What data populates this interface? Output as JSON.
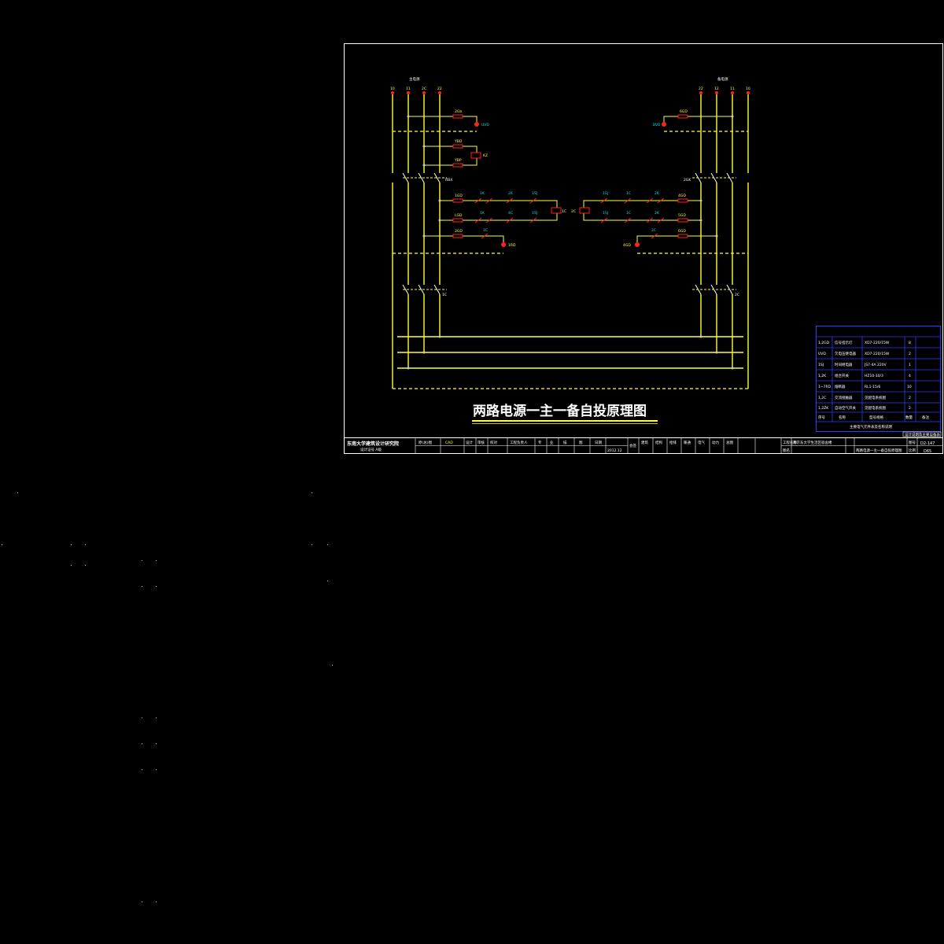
{
  "diagram": {
    "title": "两路电源一主一备自投原理图",
    "left_source_label": "主电源",
    "right_source_label": "备电源",
    "left_phases": [
      "10",
      "11",
      "2C",
      "22"
    ],
    "right_phases": [
      "22",
      "12",
      "11",
      "10"
    ],
    "left_upper_labels": [
      "2Gb",
      "UVD",
      "YBD",
      "YBP",
      "KZ",
      "RBX"
    ],
    "left_relay_labels": [
      "1GD",
      "1K",
      "2K",
      "1SJ",
      "1C",
      "LGD",
      "1K",
      "4C",
      "1SJ",
      "2GD",
      "1C",
      "1RD",
      "1C"
    ],
    "right_upper_labels": [
      "6GD",
      "BVD",
      "2GK"
    ],
    "right_relay_labels": [
      "1SJ",
      "1C",
      "2K",
      "4GD",
      "2C",
      "1SJ",
      "1C",
      "2K",
      "5GD",
      "2C",
      "6GD",
      "4GD",
      "2C"
    ]
  },
  "legend": {
    "rows": [
      [
        "1,2GD",
        "信号指示灯",
        "XD7-220/15W",
        "8",
        ""
      ],
      [
        "UVD",
        "欠电压继电器",
        "XD7-220/15W",
        "2",
        ""
      ],
      [
        "1SJ",
        "时间继电器",
        "JS7-4A 220V",
        "1",
        ""
      ],
      [
        "1,2K",
        "组合开关",
        "HZ10-10/3",
        "4",
        ""
      ],
      [
        "1~7RD",
        "熔断器",
        "RL1-15/6",
        "10",
        ""
      ],
      [
        "1,2C",
        "交流接触器",
        "见配电系统图",
        "2",
        ""
      ],
      [
        "1,2ZK",
        "自动空气开关",
        "见配电系统图",
        "2",
        ""
      ],
      [
        "序号",
        "名称",
        "型号规格",
        "数量",
        "备注"
      ]
    ],
    "footer": "主要电气元件表及名称说明",
    "note": "设计说明及主要设备表"
  },
  "title_block": {
    "institute": "东南大学建筑设计研究院",
    "institute_sub": "设计证号 A级",
    "cells": [
      "原(总)图",
      "CAD",
      "设计",
      "审核",
      "校对",
      "工程负责人",
      "专",
      "业",
      "描",
      "图",
      "日期",
      "2012.12",
      "会签"
    ],
    "cells2": [
      "建筑",
      "结构",
      "给排",
      "暖通",
      "电气",
      "动力",
      "总图"
    ],
    "project_label": "工程名称",
    "drawing_label": "图名",
    "project_name": "南京东大学生活区宿舍楼",
    "drawing_name": "两路电源一主一备自投原理图",
    "drawing_no_label": "图号",
    "drawing_no": "D2-147",
    "sheet_label": "比例",
    "sheet_no": "D65"
  }
}
